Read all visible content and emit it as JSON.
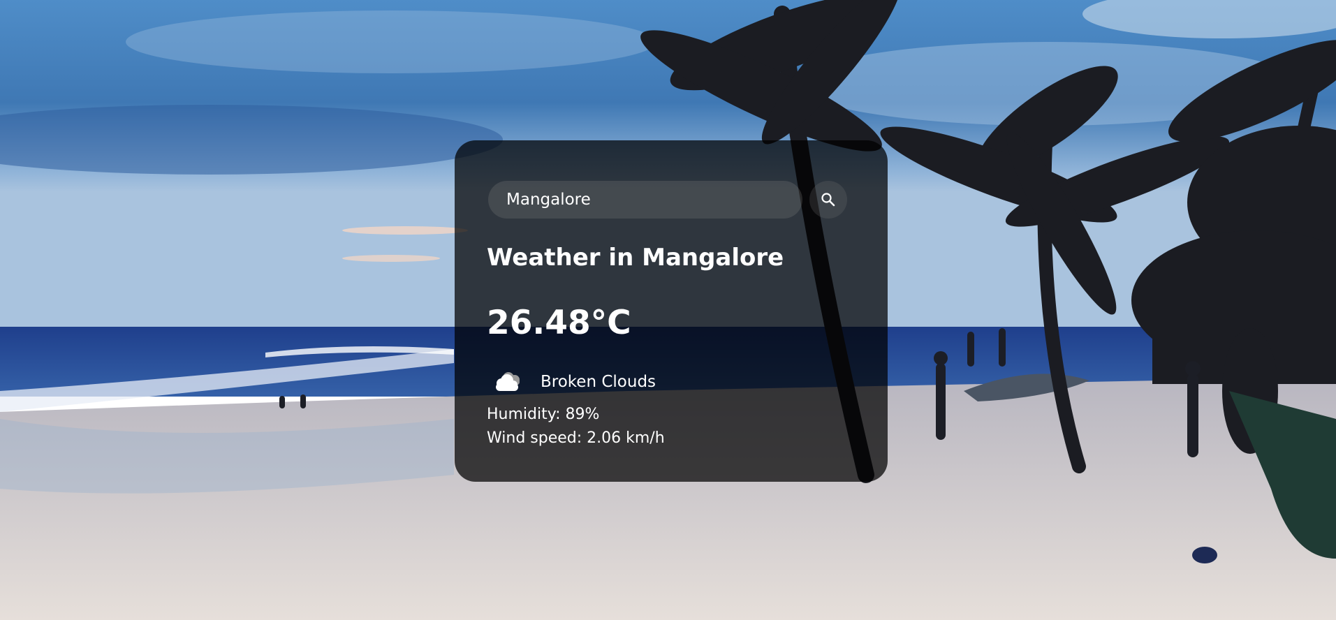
{
  "search": {
    "value": "Mangalore",
    "placeholder": "Search"
  },
  "weather": {
    "title": "Weather in Mangalore",
    "temperature": "26.48°C",
    "description": "Broken Clouds",
    "humidity": "Humidity: 89%",
    "wind": "Wind speed: 2.06 km/h"
  },
  "icons": {
    "search": "search-icon",
    "condition": "broken-clouds-icon"
  },
  "colors": {
    "card_background": "rgba(0,0,0,0.72)",
    "text": "#ffffff",
    "search_field": "#7d7d7d"
  }
}
